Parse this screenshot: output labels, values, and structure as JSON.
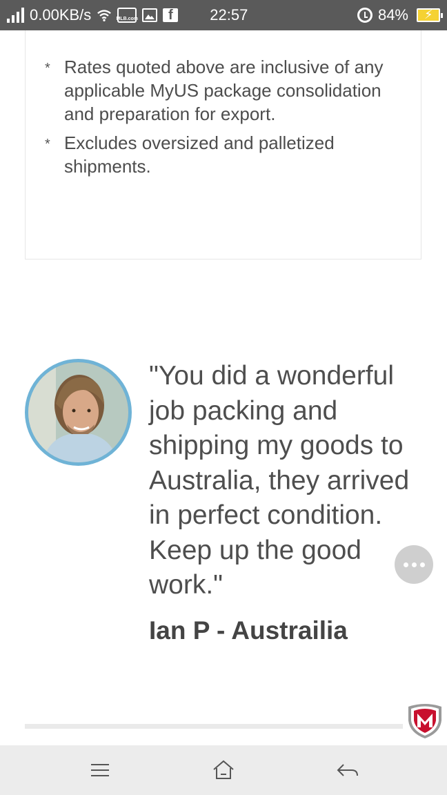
{
  "status_bar": {
    "network_speed": "0.00KB/s",
    "time": "22:57",
    "battery": "84%",
    "mlb_label": "MLB.com"
  },
  "notes": [
    {
      "bullet": "*",
      "text": "Rates quoted above are inclusive of any applicable MyUS package consolidation and preparation for export."
    },
    {
      "bullet": "*",
      "text": "Excludes oversized and palletized shipments."
    }
  ],
  "testimonial": {
    "quote": "\"You did a wonderful job packing and shipping my goods to Australia, they arrived in perfect condition. Keep up the good work.\"",
    "author": "Ian P - Austrailia",
    "avatar_border_color": "#6fb3d6"
  },
  "colors": {
    "status_bar_bg": "#5a5a5a",
    "text": "#4e4e4e",
    "nav_bg": "#ececec",
    "mcafee_red": "#c8102e"
  }
}
